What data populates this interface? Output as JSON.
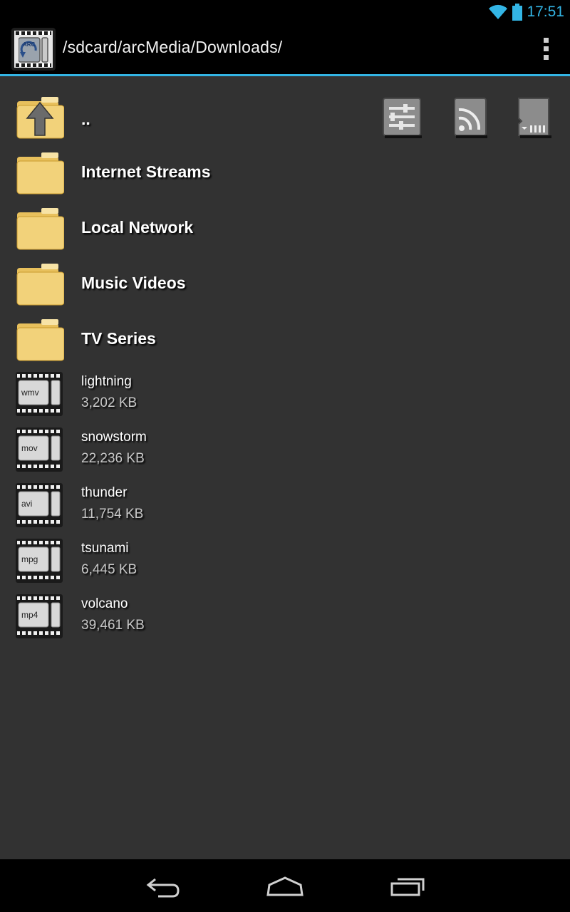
{
  "status_bar": {
    "time": "17:51"
  },
  "action_bar": {
    "path": "/sdcard/arcMedia/Downloads/",
    "app_icon_label": "ARC"
  },
  "list": {
    "parent_label": "..",
    "folders": [
      {
        "label": "Internet Streams"
      },
      {
        "label": "Local Network"
      },
      {
        "label": "Music Videos"
      },
      {
        "label": "TV Series"
      }
    ],
    "files": [
      {
        "name": "lightning",
        "size": "3,202 KB",
        "ext": "wmv"
      },
      {
        "name": "snowstorm",
        "size": "22,236 KB",
        "ext": "mov"
      },
      {
        "name": "thunder",
        "size": "11,754 KB",
        "ext": "avi"
      },
      {
        "name": "tsunami",
        "size": "6,445 KB",
        "ext": "mpg"
      },
      {
        "name": "volcano",
        "size": "39,461 KB",
        "ext": "mp4"
      }
    ]
  },
  "toolbar_icons": [
    "settings-sliders-icon",
    "rss-feed-icon",
    "sd-card-icon"
  ],
  "colors": {
    "accent": "#33b5e5",
    "background": "#323232",
    "folder": "#f2d27a"
  }
}
